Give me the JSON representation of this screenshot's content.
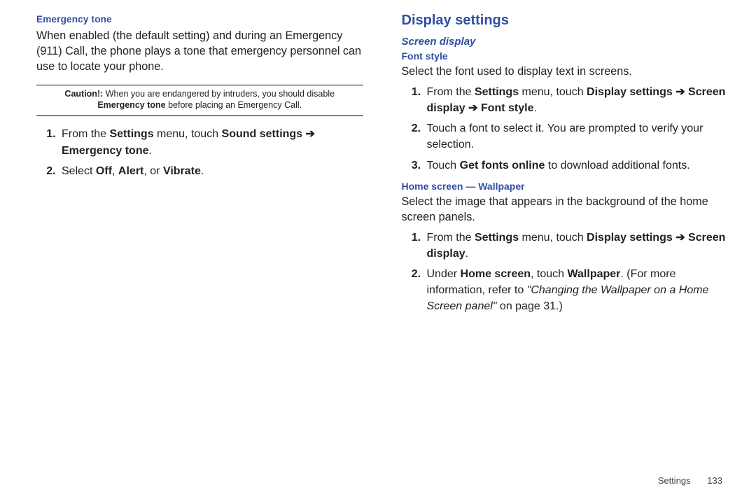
{
  "left": {
    "heading": "Emergency tone",
    "intro": "When enabled (the default setting) and during an Emergency (911) Call, the phone plays a tone that emergency personnel can use to locate your phone.",
    "caution_lead": "Caution!:",
    "caution_a": " When you are endangered by intruders, you should disable ",
    "caution_b": "Emergency tone",
    "caution_c": " before placing an Emergency Call.",
    "s1_a": "From the ",
    "s1_b": "Settings",
    "s1_c": " menu, touch ",
    "s1_d": "Sound settings",
    "s1_arrow": " ➔ ",
    "s1_e": "Emergency tone",
    "s1_f": ".",
    "s2_a": "Select ",
    "s2_b": "Off",
    "s2_c": ", ",
    "s2_d": "Alert",
    "s2_e": ", or ",
    "s2_f": "Vibrate",
    "s2_g": "."
  },
  "right": {
    "display_heading": "Display settings",
    "screen_heading": "Screen display",
    "font_heading": "Font style",
    "font_intro": "Select the font used to display text in screens.",
    "f1_a": "From the ",
    "f1_b": "Settings",
    "f1_c": " menu, touch ",
    "f1_d": "Display settings",
    "f1_arrow": " ➔ ",
    "f1_e": "Screen display",
    "f1_arrow2": " ➔ ",
    "f1_f": "Font style",
    "f1_g": ".",
    "f2": "Touch a font to select it. You are prompted to verify your selection.",
    "f3_a": "Touch ",
    "f3_b": "Get fonts online",
    "f3_c": " to download additional fonts.",
    "home_heading": "Home screen — Wallpaper",
    "home_intro": "Select the image that appears in the background of the home screen panels.",
    "h1_a": "From the ",
    "h1_b": "Settings",
    "h1_c": " menu, touch ",
    "h1_d": "Display settings",
    "h1_arrow": " ➔ ",
    "h1_e": "Screen display",
    "h1_f": ".",
    "h2_a": "Under ",
    "h2_b": "Home screen",
    "h2_c": ", touch ",
    "h2_d": "Wallpaper",
    "h2_e": ". (For more information, refer to ",
    "h2_f": "\"Changing the Wallpaper on a Home Screen panel\"",
    "h2_g": " on page 31.)"
  },
  "footer": {
    "section": "Settings",
    "page": "133"
  }
}
